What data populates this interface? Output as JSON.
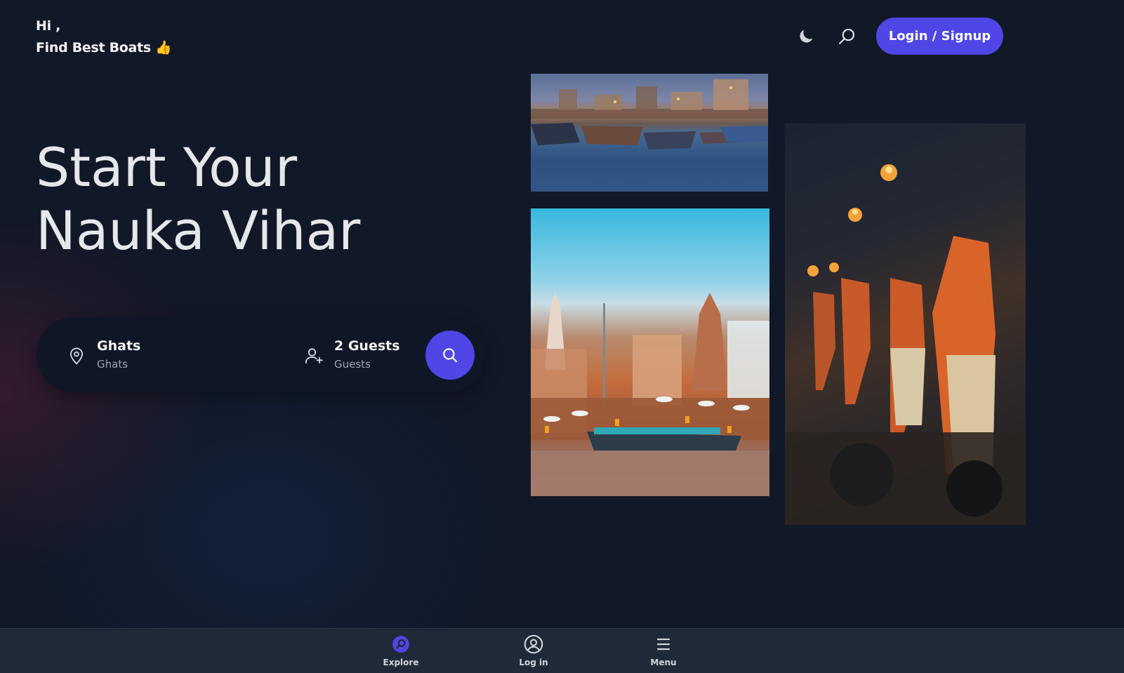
{
  "header": {
    "greeting_line1": "Hi ,",
    "greeting_line2": "Find Best Boats",
    "greeting_emoji": "👍",
    "theme_icon": "moon-icon",
    "search_icon": "search-icon",
    "login_label": "Login / Signup"
  },
  "hero": {
    "title_line1": "Start Your",
    "title_line2": "Nauka Vihar"
  },
  "search_bar": {
    "location_value": "Ghats",
    "location_label": "Ghats",
    "location_icon": "map-pin-icon",
    "guests_value": "2 Guests",
    "guests_label": "Guests",
    "guests_icon": "add-user-icon",
    "search_button_icon": "search-icon"
  },
  "gallery": {
    "images": [
      "boats-at-ghat-dusk",
      "varanasi-ghat-temples",
      "ganga-aarti-ceremony"
    ]
  },
  "bottom_nav": {
    "items": [
      {
        "label": "Explore",
        "icon": "explore-icon",
        "active": true
      },
      {
        "label": "Log in",
        "icon": "user-circle-icon",
        "active": false
      },
      {
        "label": "Menu",
        "icon": "menu-icon",
        "active": false
      }
    ]
  },
  "colors": {
    "background": "#111827",
    "accent": "#4f46e5",
    "nav_background": "#1f2937",
    "text_primary": "#e5e7eb",
    "text_muted": "#9ca3af"
  }
}
